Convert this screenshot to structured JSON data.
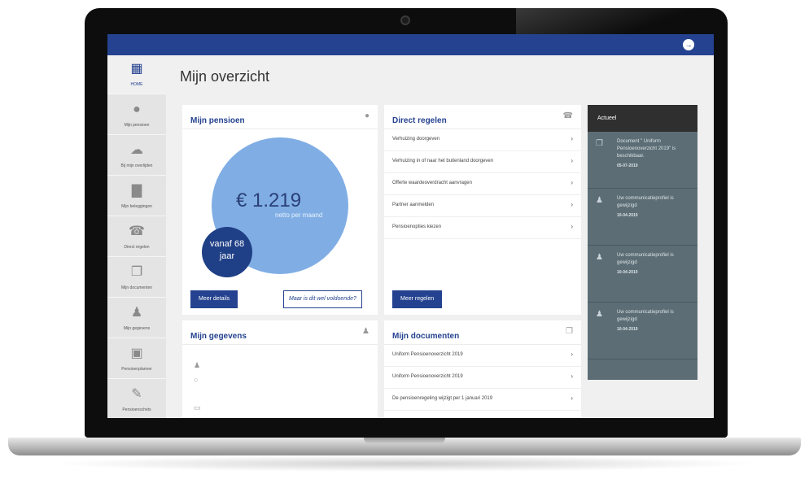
{
  "header": {
    "logout_icon": "logout-icon"
  },
  "sidebar": {
    "items": [
      {
        "label": "HOME",
        "icon": "grid-icon"
      },
      {
        "label": "Mijn pensioen",
        "icon": "piggy-bank-icon"
      },
      {
        "label": "Bij mijn overlijden",
        "icon": "cloud-icon"
      },
      {
        "label": "Mijn beleggingen",
        "icon": "bar-chart-icon"
      },
      {
        "label": "Direct regelen",
        "icon": "phone-icon"
      },
      {
        "label": "Mijn documenten",
        "icon": "documents-icon"
      },
      {
        "label": "Mijn gegevens",
        "icon": "user-icon"
      },
      {
        "label": "Pensioenplanner",
        "icon": "calculator-icon"
      },
      {
        "label": "Pensioenschets",
        "icon": "pencil-icon"
      }
    ]
  },
  "page": {
    "title": "Mijn overzicht"
  },
  "pensioen": {
    "title": "Mijn pensioen",
    "amount": "€ 1.219",
    "amount_sub": "netto per maand",
    "age_line1": "vanaf 68",
    "age_line2": "jaar",
    "details_button": "Meer details",
    "enough_button": "Maar is dit wel voldoende?"
  },
  "regelen": {
    "title": "Direct regelen",
    "items": [
      "Verhuizing doorgeven",
      "Verhuizing in of naar het buitenland doorgeven",
      "Offerte waardeoverdracht aanvragen",
      "Partner aanmelden",
      "Pensioenopties kiezen"
    ],
    "more_button": "Meer regelen"
  },
  "gegevens": {
    "title": "Mijn gegevens"
  },
  "documenten": {
    "title": "Mijn documenten",
    "items": [
      "Uniform Pensioenoverzicht 2019",
      "Uniform Pensioenoverzicht 2019",
      "De pensioenregeling wijzigt per 1 januari 2019"
    ]
  },
  "actueel": {
    "title": "Actueel",
    "items": [
      {
        "text": "Document \" Uniform Pensioenoverzicht 2019\" is beschikbaar.",
        "date": "05-07-2019",
        "icon": "document-icon"
      },
      {
        "text": "Uw communicatieprofiel is gewijzigd",
        "date": "10-04-2019",
        "icon": "user-icon"
      },
      {
        "text": "Uw communicatieprofiel is gewijzigd",
        "date": "10-04-2019",
        "icon": "user-icon"
      },
      {
        "text": "Uw communicatieprofiel is gewijzigd",
        "date": "10-04-2019",
        "icon": "user-icon"
      }
    ]
  }
}
